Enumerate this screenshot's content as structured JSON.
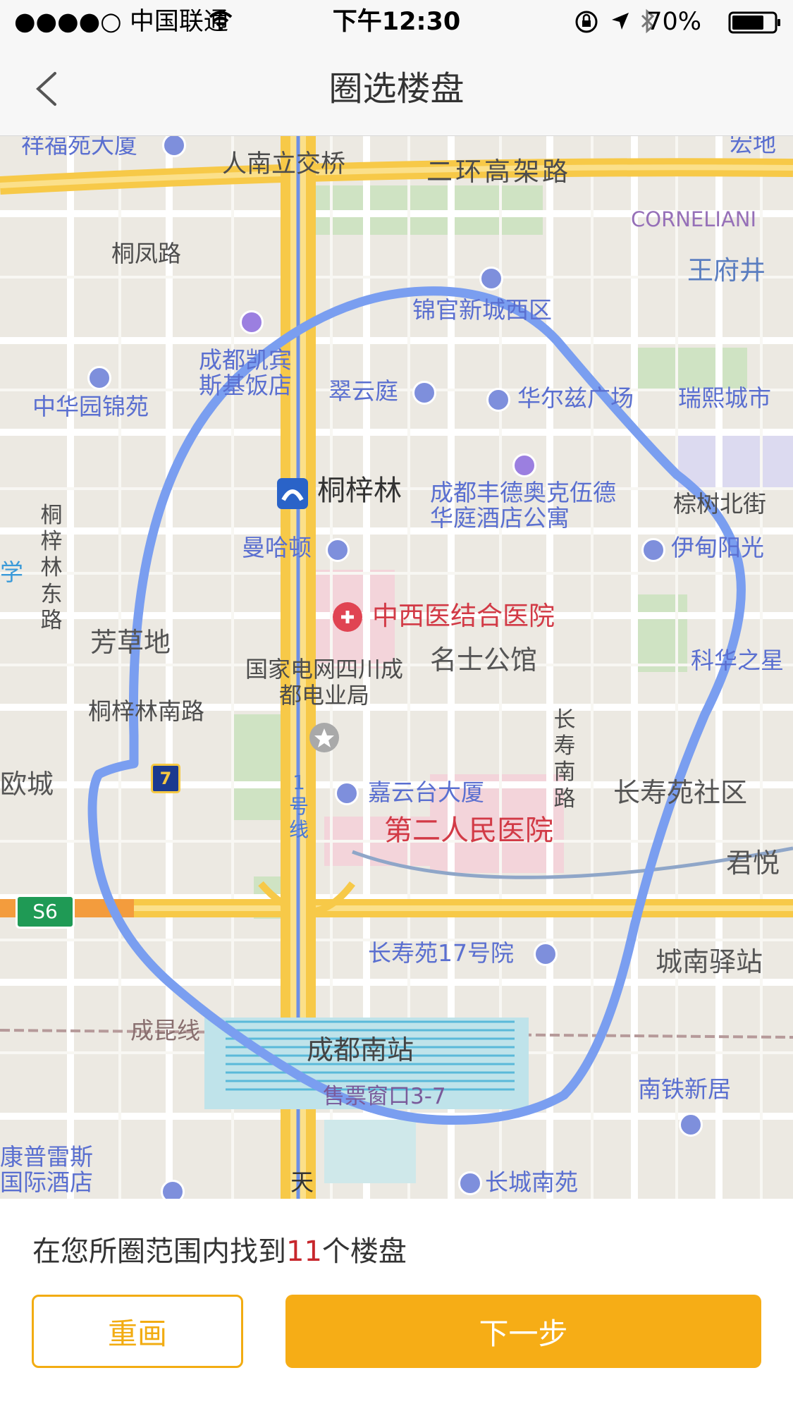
{
  "status_bar": {
    "carrier": "●●●●○ 中国联通",
    "time": "下午12:30",
    "battery": "70%"
  },
  "nav": {
    "title": "圈选楼盘"
  },
  "map": {
    "labels": {
      "xiangfuyuan": "祥福苑大厦",
      "hongdi": "宏地",
      "rennanlijiao": "人南立交桥",
      "erhuan": "二环高架路",
      "corneliani": "CORNELIANI",
      "tongfeng": "桐凤路",
      "wangfujing": "王府井",
      "jinguan": "锦官新城西区",
      "kaibin": "成都凯宾斯基饭店",
      "zhonghuayuan": "中华园锦苑",
      "cuiyunting": "翠云庭",
      "huaerzi": "华尔兹广场",
      "ruixi": "瑞熙城市",
      "tongzilin": "桐梓林",
      "fengde": "成都丰德奥克伍德华庭酒店公寓",
      "zongbei": "棕树北街",
      "tongzilin_east": "桐梓林东路",
      "manhadun": "曼哈顿",
      "yidian": "伊甸阳光",
      "xue": "学",
      "zhongxiyi": "中西医结合医院",
      "fangcaodi": "芳草地",
      "guojiadianwang": "国家电网四川成都电业局",
      "mingshi": "名士公馆",
      "kehua": "科华之星",
      "tongzilin_south": "桐梓林南路",
      "changshou_road": "长寿南路",
      "ouzheng": "欧城",
      "line1": "1号线",
      "jiayuntai": "嘉云台大厦",
      "changshouyuan": "长寿苑社区",
      "dierrenmin": "第二人民医院",
      "junyue": "君悦",
      "s6": "S6",
      "metro7": "7",
      "changshou17": "长寿苑17号院",
      "chengnan": "城南驿站",
      "chengkun": "成昆线",
      "nanzhan": "成都南站",
      "shoupiao": "售票窗口3-7",
      "nantie": "南铁新居",
      "kangpu": "康普雷斯国际酒店",
      "tian": "天",
      "changcheng": "长城南苑"
    }
  },
  "result": {
    "prefix": "在您所圈范围内找到",
    "count": "11",
    "suffix": "个楼盘"
  },
  "buttons": {
    "redraw": "重画",
    "next": "下一步"
  },
  "colors": {
    "accent": "#f6ad16",
    "count": "#c7262c",
    "selection": "#7a9ef0"
  }
}
